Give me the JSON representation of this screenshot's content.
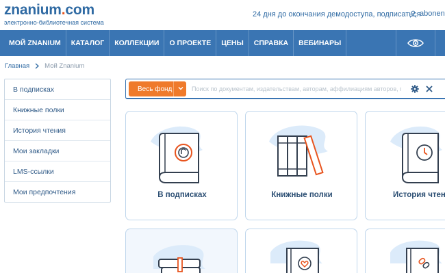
{
  "header": {
    "logo_main": "znanium",
    "logo_dot": ".",
    "logo_tld": "com",
    "logo_sub": "электронно-библиотечная система",
    "demo_notice": "24 дня до окончания демодоступа, подписаться",
    "user_name": "abonent-",
    "user_icon": "user-icon"
  },
  "nav": {
    "items": [
      "МОЙ ZNANIUM",
      "КАТАЛОГ",
      "КОЛЛЕКЦИИ",
      "О ПРОЕКТЕ",
      "ЦЕНЫ",
      "СПРАВКА",
      "ВЕБИНАРЫ"
    ],
    "eye_icon": "eye-icon"
  },
  "breadcrumb": {
    "home": "Главная",
    "current": "Мой Znanium"
  },
  "sidebar": {
    "items": [
      "В подписках",
      "Книжные полки",
      "История чтения",
      "Мои закладки",
      "LMS-ссылки",
      "Мои предпочтения"
    ]
  },
  "search": {
    "fund_label": "Весь фонд",
    "placeholder": "Поиск по документам, издательствам, авторам, аффилиациям авторов, пери...",
    "value": ""
  },
  "cards": [
    {
      "label": "В подписках",
      "icon": "lock-book-icon"
    },
    {
      "label": "Книжные полки",
      "icon": "bookshelf-icon"
    },
    {
      "label": "История чтени",
      "icon": "clock-book-icon"
    },
    {
      "label": "",
      "icon": "stacked-books-icon"
    },
    {
      "label": "",
      "icon": "heart-book-icon"
    },
    {
      "label": "",
      "icon": "link-book-icon"
    }
  ],
  "colors": {
    "brand_blue": "#3a75b3",
    "accent_orange": "#ef7a2b",
    "text_blue": "#2f6aa3"
  }
}
